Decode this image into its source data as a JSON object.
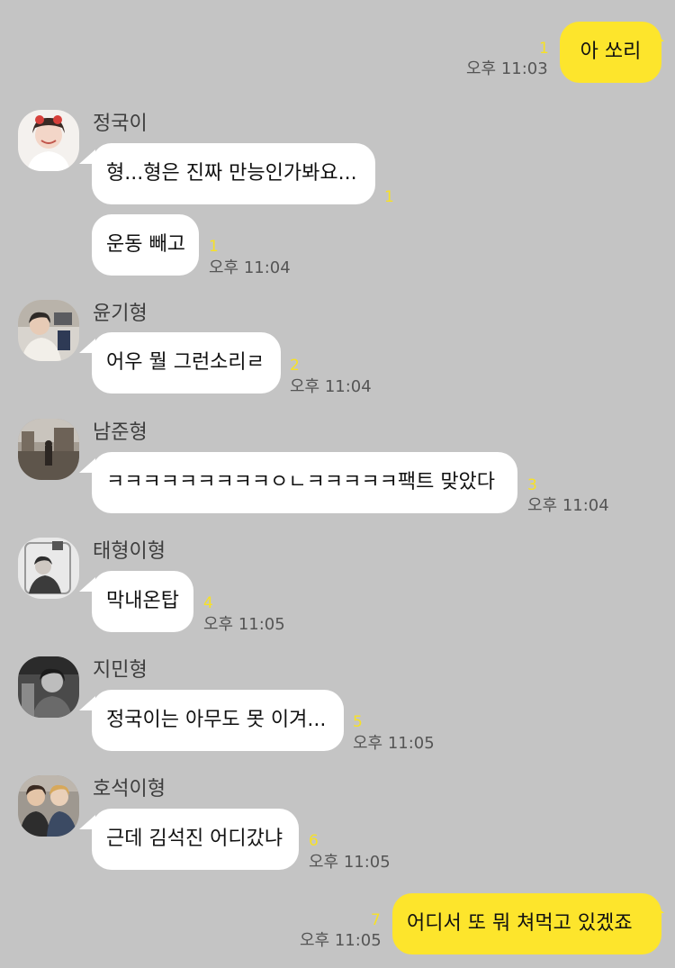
{
  "messages": [
    {
      "sender": "",
      "text": "아 쏘리",
      "unread": "1",
      "time": "오후 11:03",
      "mine": true
    },
    {
      "sender": "정국이",
      "text": "형...형은 진짜 만능인가봐요...",
      "unread": "1",
      "time": ""
    },
    {
      "sender": "",
      "text": "운동 빼고",
      "unread": "1",
      "time": "오후 11:04"
    },
    {
      "sender": "윤기형",
      "text": "어우 뭘 그런소리ㄹ",
      "unread": "2",
      "time": "오후 11:04"
    },
    {
      "sender": "남준형",
      "text": "ㅋㅋㅋㅋㅋㅋㅋㅋㅋㅇㄴㅋㅋㅋㅋㅋ팩트 맞았다",
      "unread": "3",
      "time": "오후 11:04"
    },
    {
      "sender": "태형이형",
      "text": "막내온탑",
      "unread": "4",
      "time": "오후 11:05"
    },
    {
      "sender": "지민형",
      "text": "정국이는 아무도 못 이겨...",
      "unread": "5",
      "time": "오후 11:05"
    },
    {
      "sender": "호석이형",
      "text": "근데 김석진 어디갔냐",
      "unread": "6",
      "time": "오후 11:05"
    },
    {
      "sender": "",
      "text": "어디서 또 뭐 쳐먹고 있겠죠",
      "unread": "7",
      "time": "오후 11:05",
      "mine": true
    }
  ],
  "avatars": [
    "jungkook-avatar",
    "yoongi-avatar",
    "namjoon-avatar",
    "taehyung-avatar",
    "jimin-avatar",
    "hoseok-avatar"
  ],
  "colors": {
    "background": "#c4c4c4",
    "my_bubble": "#fde52c",
    "other_bubble": "#ffffff",
    "unread": "#f7e126",
    "time": "#555555"
  }
}
